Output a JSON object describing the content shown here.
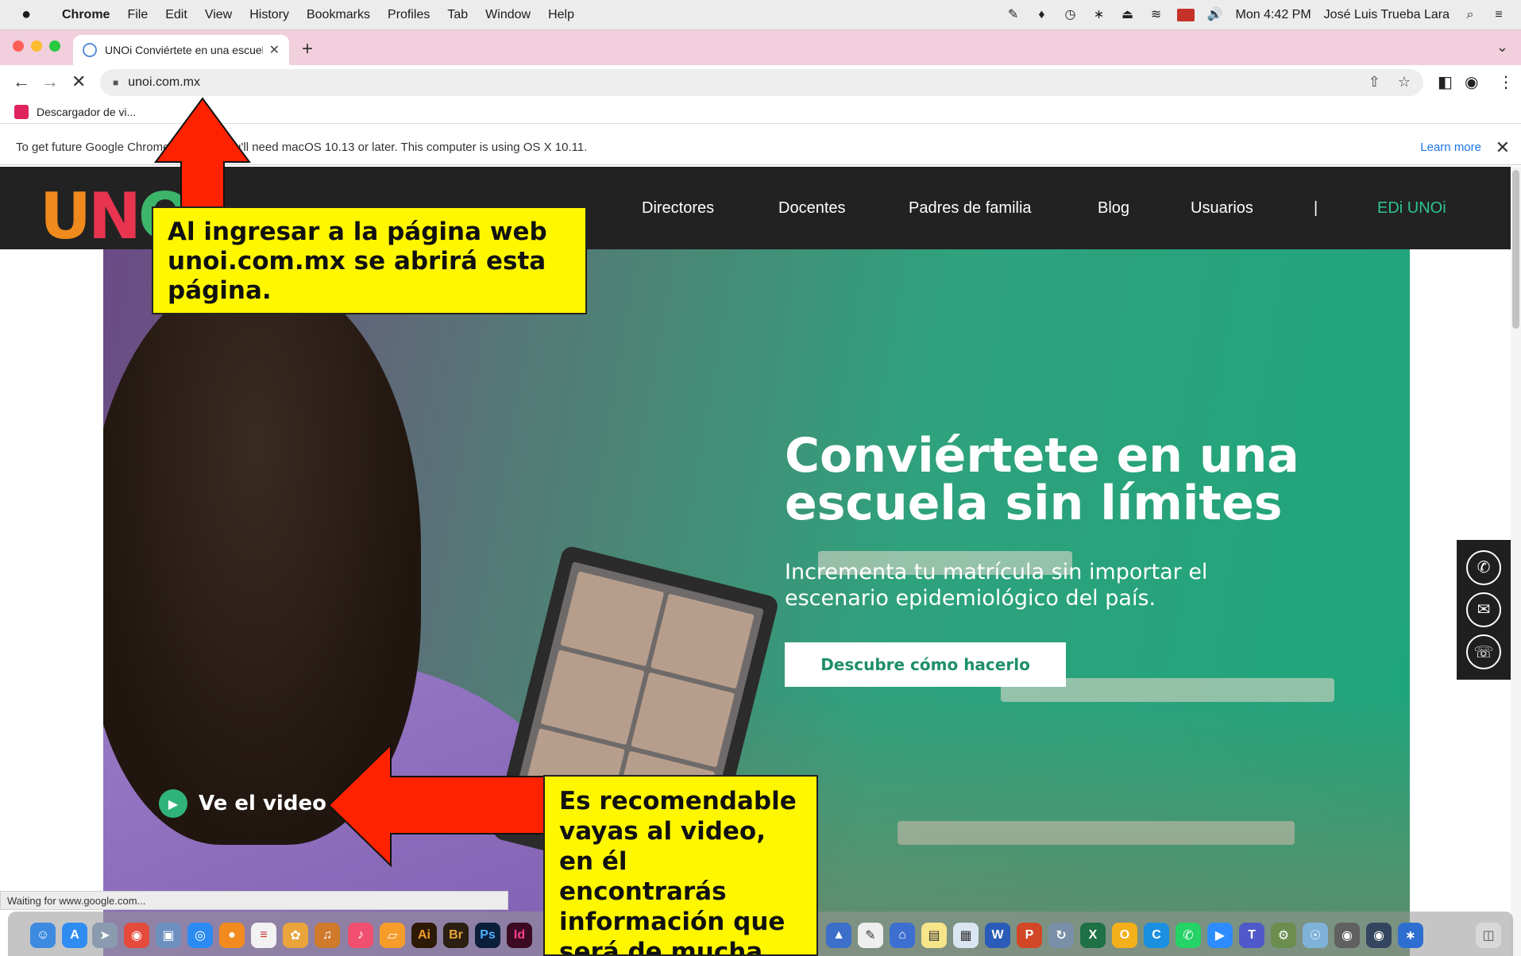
{
  "menubar": {
    "apple": "",
    "items": [
      "Chrome",
      "File",
      "Edit",
      "View",
      "History",
      "Bookmarks",
      "Profiles",
      "Tab",
      "Window",
      "Help"
    ],
    "clock": "Mon 4:42 PM",
    "user": "José Luis Trueba Lara"
  },
  "browser": {
    "tab_title": "UNOi Conviértete en una escuela",
    "url": "unoi.com.mx",
    "bookmark_label": "Descargador de vi...",
    "infobar_text": "To get future Google Chrome updates, you'll need macOS 10.13 or later. This computer is using OS X 10.11.",
    "infobar_link": "Learn more",
    "status_text": "Waiting for www.google.com..."
  },
  "site": {
    "nav": [
      "Directores",
      "Docentes",
      "Padres de familia",
      "Blog",
      "Usuarios",
      "|",
      "EDi UNOi"
    ],
    "hero_title": "Conviértete en una escuela sin límites",
    "hero_subtitle": "Incrementa tu matrícula sin importar el escenario epidemiológico del país.",
    "hero_button": "Descubre cómo hacerlo",
    "video_link": "Ve el video"
  },
  "annotations": {
    "callout_top": "Al ingresar a la página web unoi.com.mx se abrirá esta página.",
    "callout_bottom": "Es recomendable vayas al video, en él encontrarás información que será de mucha utilidad."
  },
  "colors": {
    "brand_green": "#1fa57b",
    "callout_yellow": "#fff700",
    "arrow_red": "#ff2200",
    "site_header": "#222222"
  }
}
